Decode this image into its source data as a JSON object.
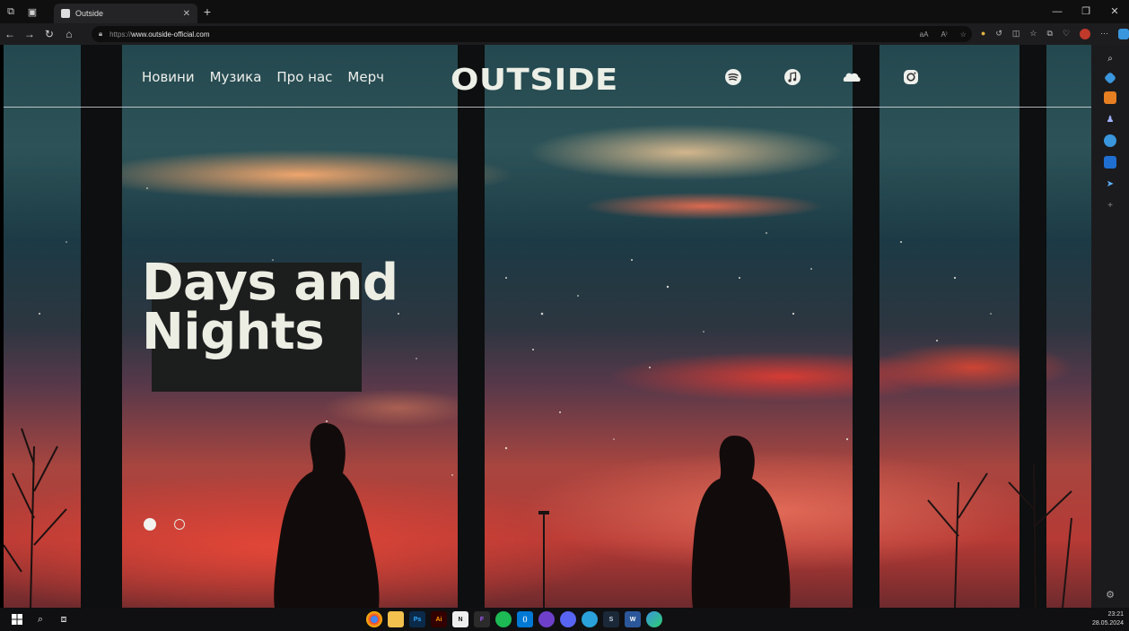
{
  "browser": {
    "tab_title": "Outside",
    "url_protocol": "https://",
    "url_host": "www.outside-official.com",
    "url_tools": [
      "аА",
      "A⁾",
      "☆"
    ]
  },
  "site": {
    "nav": [
      "Новини",
      "Музика",
      "Про нас",
      "Мерч"
    ],
    "logo": "OUTSIDE",
    "socials": [
      "spotify-icon",
      "apple-music-icon",
      "soundcloud-icon",
      "instagram-icon"
    ],
    "hero": {
      "line1": "Days and",
      "line2": "Nights"
    },
    "slider": {
      "count": 2,
      "active": 1
    }
  },
  "taskbar": {
    "time": "23:21",
    "date": "28.05.2024"
  },
  "colors": {
    "accent_edge": "#3a96dd",
    "hero_text": "#ecede3",
    "sky_red": "#b63a35",
    "sky_teal": "#2d5358"
  }
}
